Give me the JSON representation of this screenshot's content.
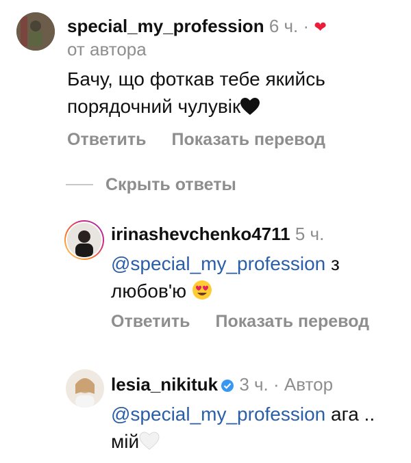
{
  "comments": [
    {
      "username": "special_my_profession",
      "time": "6 ч.",
      "dot": "·",
      "liked_by_author": "от автора",
      "text": "Бачу, що фоткав тебе якийсь порядочний чулувік",
      "emoji": "black-heart",
      "actions": [
        "Ответить",
        "Показать перевод"
      ]
    }
  ],
  "hide_replies": "Скрыть ответы",
  "replies": [
    {
      "username": "irinashevchenko4711",
      "time": "5 ч.",
      "mention": "@special_my_profession",
      "text": "з любов'ю",
      "emoji": "heart-eyes",
      "actions": [
        "Ответить",
        "Показать перевод"
      ]
    },
    {
      "username": "lesia_nikituk",
      "time": "3 ч.",
      "dot": "·",
      "author_badge": "Автор",
      "verified": true,
      "mention": "@special_my_profession",
      "text": "ага .. мій",
      "emoji": "white-heart"
    }
  ],
  "colors": {
    "accent_link": "#2b5ea8",
    "muted": "#8e8e8e",
    "like_heart": "#ed1c3a",
    "verified": "#3897f0"
  }
}
